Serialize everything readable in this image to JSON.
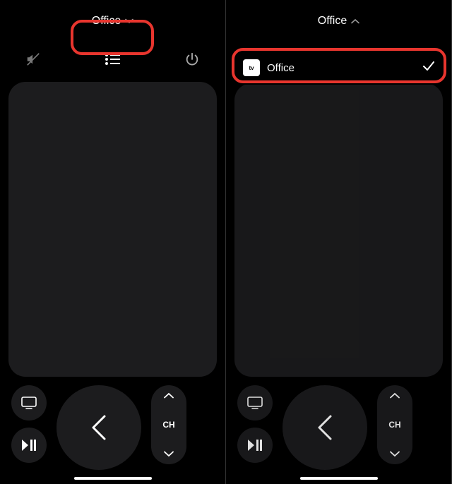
{
  "left": {
    "deviceName": "Office",
    "chevronDirection": "down",
    "ch": "CH"
  },
  "right": {
    "deviceName": "Office",
    "chevronDirection": "up",
    "ch": "CH",
    "dropdown": {
      "iconLabel": "tv",
      "item": "Office"
    }
  }
}
